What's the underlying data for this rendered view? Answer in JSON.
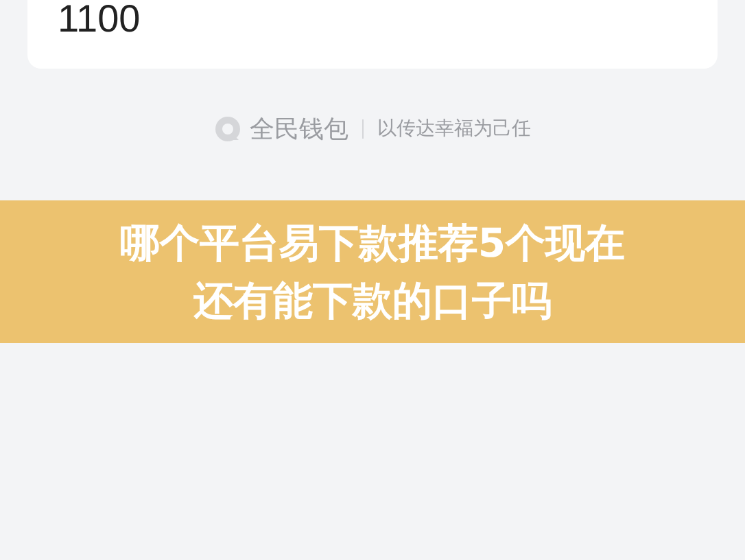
{
  "amount": "1100",
  "brand": {
    "name": "全民钱包",
    "slogan": "以传达幸福为己任"
  },
  "banner": {
    "title_lines": [
      "哪个平台易下款推荐5个现在",
      "还有能下款的口子吗"
    ]
  }
}
